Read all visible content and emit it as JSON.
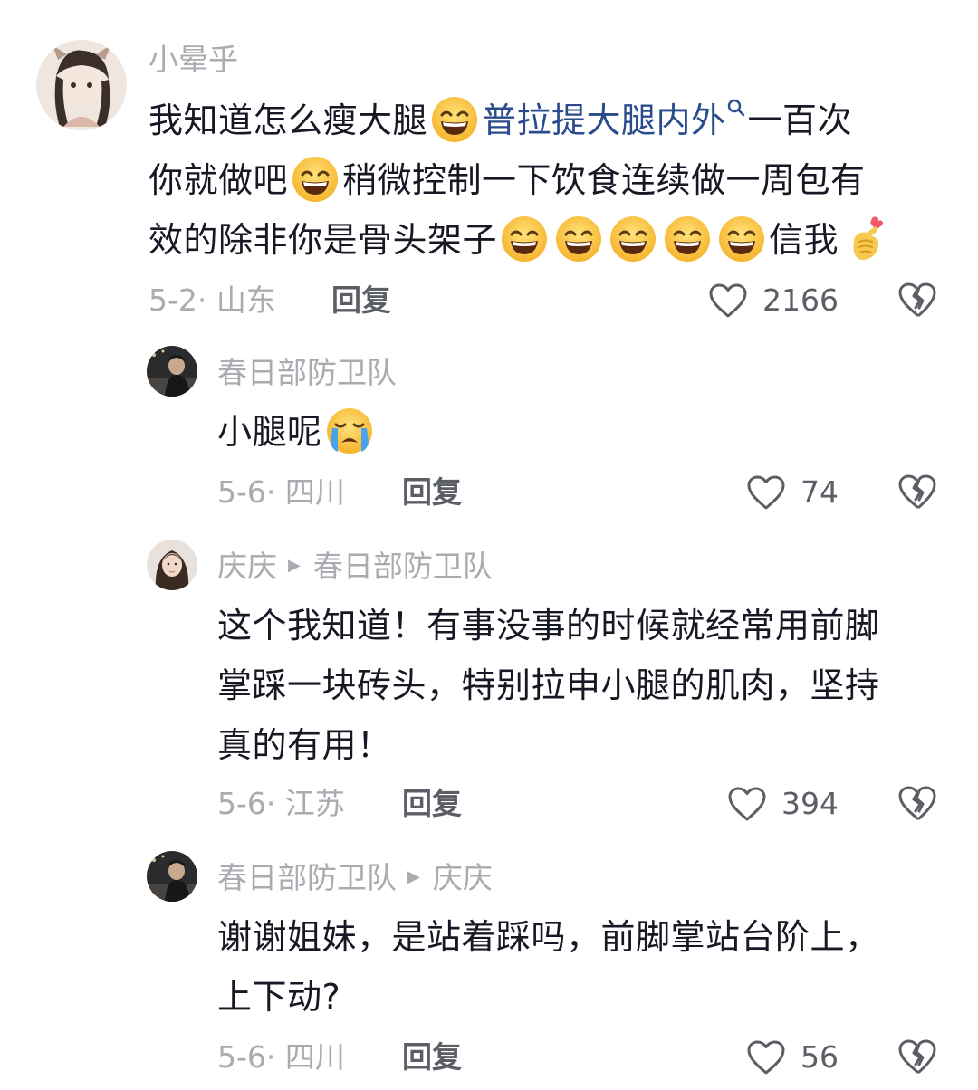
{
  "comments": [
    {
      "username": "小晕乎",
      "text_parts": [
        "我知道怎么瘦大腿",
        "普拉提大腿内外",
        "一百次",
        "你就做吧",
        "稍微控制一下饮食连续做一周包有",
        "效的除非你是骨头架子",
        "信我"
      ],
      "date": "5-2",
      "location": "山东",
      "reply_label": "回复",
      "likes": "2166",
      "link_color": "#2a4c8c"
    },
    {
      "username": "春日部防卫队",
      "text": "小腿呢",
      "date": "5-6",
      "location": "四川",
      "reply_label": "回复",
      "likes": "74"
    },
    {
      "username": "庆庆",
      "reply_to": "春日部防卫队",
      "text_lines": [
        "这个我知道！有事没事的时候就经常用前脚",
        "掌踩一块砖头，特别拉申小腿的肌肉，坚持",
        "真的有用！"
      ],
      "date": "5-6",
      "location": "江苏",
      "reply_label": "回复",
      "likes": "394"
    },
    {
      "username": "春日部防卫队",
      "reply_to": "庆庆",
      "text_lines": [
        "谢谢姐妹，是站着踩吗，前脚掌站台阶上，",
        "上下动?"
      ],
      "date": "5-6",
      "location": "四川",
      "reply_label": "回复",
      "likes": "56"
    }
  ],
  "icons": {
    "like": "heart-outline-icon",
    "dislike": "broken-heart-icon",
    "grin": "grinning-emoji-icon",
    "cry": "crying-emoji-icon",
    "finger_heart": "finger-heart-emoji-icon",
    "search": "search-icon"
  },
  "colors": {
    "text": "#161823",
    "muted": "#a9abb0",
    "reply": "#5c5e66",
    "link": "#2a4c8c"
  }
}
